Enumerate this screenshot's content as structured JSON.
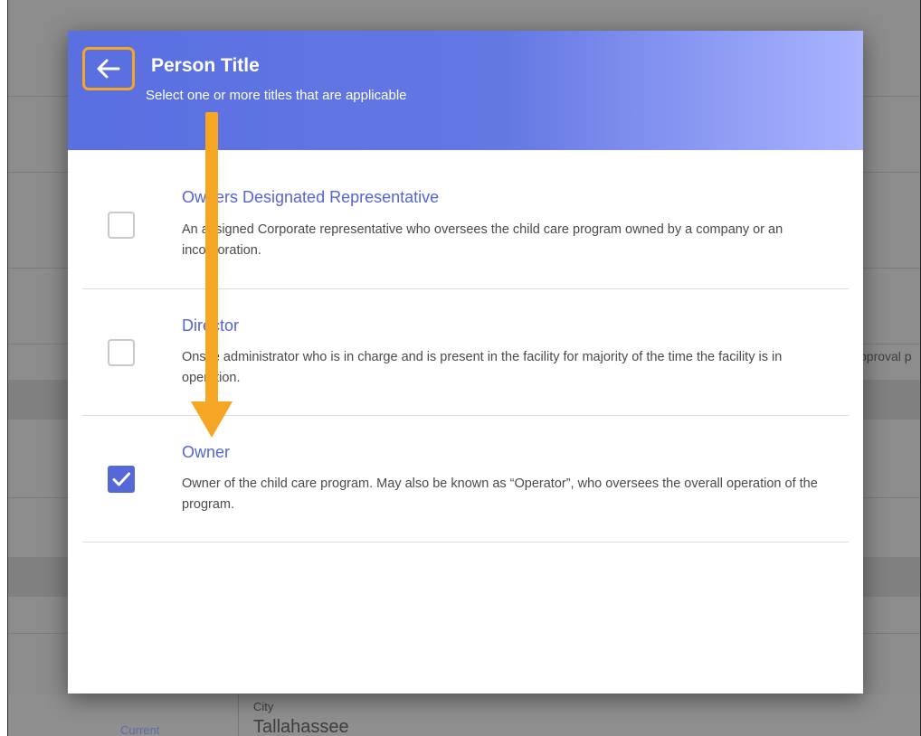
{
  "dialog": {
    "title": "Person Title",
    "subtitle": "Select one or more titles that are applicable",
    "back_icon": "arrow-left-icon",
    "accent_color": "#5468d8",
    "highlight_color": "#f5a623",
    "items": [
      {
        "title": "Owners Designated Representative",
        "description": "An assigned Corporate representative who oversees the child care program owned by a company or an incorporation.",
        "checked": false
      },
      {
        "title": "Director",
        "description": "Onsite administrator who is in charge and is present in the facility for majority of the time the facility is in operation.",
        "checked": false
      },
      {
        "title": "Owner",
        "description": "Owner of the child care program. May also be known as “Operator”, who oversees the overall operation of the program.",
        "checked": true
      }
    ]
  },
  "background": {
    "partial_text": "pproval p",
    "city_label": "City",
    "city_value": "Tallahassee",
    "current_label": "Current"
  }
}
